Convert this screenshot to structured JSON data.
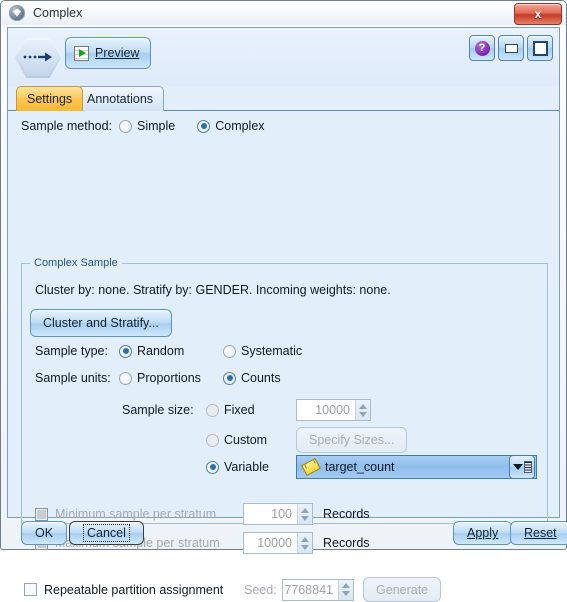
{
  "window": {
    "title": "Complex",
    "title_icon": "node-gem-icon",
    "close_label": "x"
  },
  "toolbar": {
    "node_icon": "sample-node-icon",
    "preview_label": "Preview",
    "preview_icon": "preview-run-icon",
    "help_label": "?",
    "help_icon": "help-icon",
    "minimize_icon": "minimize-icon",
    "maximize_icon": "maximize-icon"
  },
  "tabs": [
    {
      "label": "Settings",
      "active": true
    },
    {
      "label": "Annotations",
      "active": false
    }
  ],
  "settings": {
    "sample_method": {
      "label": "Sample method:",
      "options": [
        {
          "label": "Simple",
          "selected": false,
          "enabled": true
        },
        {
          "label": "Complex",
          "selected": true,
          "enabled": true
        }
      ]
    },
    "group": {
      "title": "Complex Sample",
      "summary": "Cluster by: none. Stratify by: GENDER. Incoming weights: none.",
      "cluster_button": "Cluster and Stratify...",
      "sample_type": {
        "label": "Sample type:",
        "options": [
          {
            "label": "Random",
            "selected": true
          },
          {
            "label": "Systematic",
            "selected": false
          }
        ]
      },
      "sample_units": {
        "label": "Sample units:",
        "options": [
          {
            "label": "Proportions",
            "selected": false
          },
          {
            "label": "Counts",
            "selected": true
          }
        ]
      },
      "sample_size": {
        "label": "Sample size:",
        "fixed": {
          "label": "Fixed",
          "selected": false,
          "value": "10000",
          "enabled": false
        },
        "custom": {
          "label": "Custom",
          "selected": false,
          "button": "Specify Sizes...",
          "enabled": false
        },
        "variable": {
          "label": "Variable",
          "selected": true,
          "value": "target_count",
          "field_icon": "ruler-icon",
          "dropdown_icon": "field-picker-icon"
        }
      },
      "minimum": {
        "label": "Minimum sample per stratum",
        "checked": false,
        "enabled": false,
        "value": "100",
        "units": "Records"
      },
      "maximum": {
        "label": "Maximum sample per stratum",
        "checked": false,
        "enabled": false,
        "value": "10000",
        "units": "Records"
      }
    },
    "repeatable": {
      "label": "Repeatable partition assignment",
      "checked": false,
      "seed_label": "Seed:",
      "seed_value": "7768841",
      "generate_label": "Generate"
    }
  },
  "footer": {
    "ok": "OK",
    "cancel": "Cancel",
    "apply": "Apply",
    "reset": "Reset"
  },
  "colors": {
    "panel_bg": "#e3eefb",
    "accent_tab": "#fcc44f",
    "group_title": "#27537f",
    "selected_field": "#8fbeec"
  }
}
